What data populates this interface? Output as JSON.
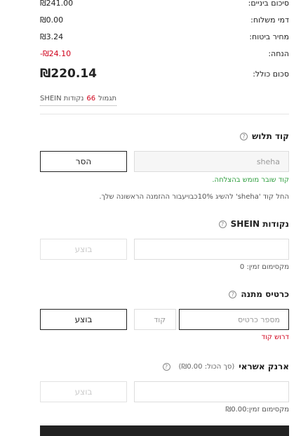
{
  "summary": {
    "subtotal_label": "סיכום ביניים:",
    "subtotal_value": "₪241.00",
    "shipping_label": "דמי משלוח:",
    "shipping_value": "₪0.00",
    "insurance_label": "מחיר ביטוח:",
    "insurance_value": "₪3.24",
    "discount_label": "הנחה:",
    "discount_value": "-₪24.10",
    "total_label": "סכום כולל:",
    "total_value": "₪220.14"
  },
  "reward": {
    "prefix": "תגמול",
    "points": "66",
    "suffix": "נקודות SHEIN"
  },
  "coupon": {
    "title": "קוד תלוש",
    "help_icon": "?",
    "input_value": "sheha",
    "remove_label": "הסר",
    "success_text": "קוד שובר מומש בהצלחה.",
    "info_text": "החל קוד 'sheha' להשיג 10%כבויעבור ההזמנה הראשונה שלך."
  },
  "points": {
    "title": "נקודות SHEIN",
    "help_icon": "?",
    "apply_label": "בוצע",
    "max_text": "מקסימום זמין: 0"
  },
  "gift_card": {
    "title": "כרטיס מתנה",
    "help_icon": "?",
    "number_placeholder": "מספר כרטיס",
    "pin_placeholder": "קוד",
    "apply_label": "בוצע",
    "error_text": "דרוש קוד"
  },
  "wallet": {
    "title": "ארנק אשראי",
    "total_hint": "(סך הכול: ₪0.00)",
    "help_icon": "?",
    "apply_label": "בוצע",
    "max_text": "מקסימום זמין:₪0.00"
  }
}
